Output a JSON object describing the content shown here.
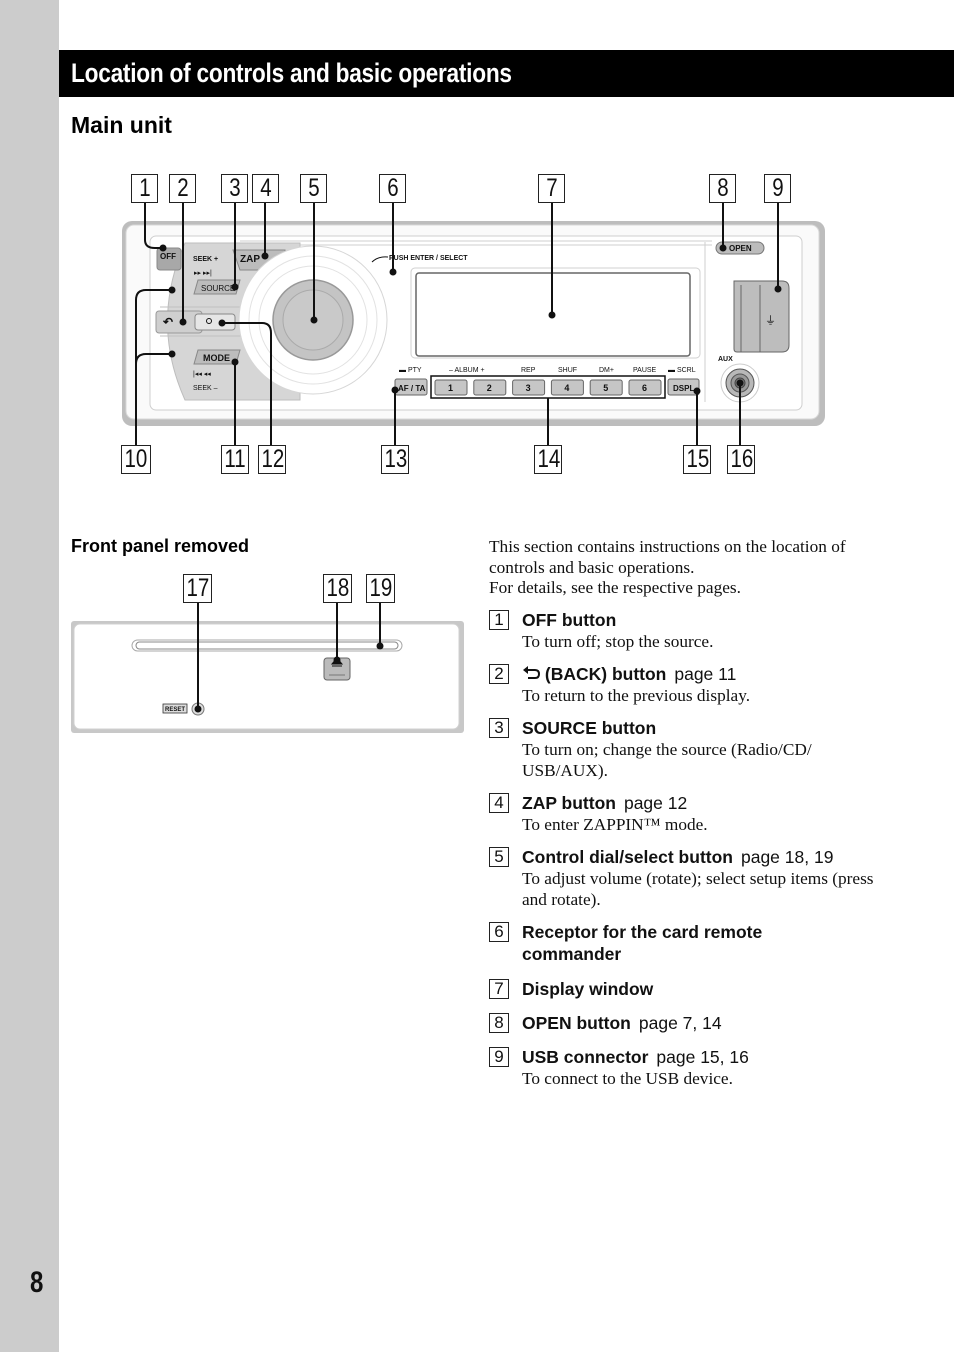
{
  "page": {
    "number": "8",
    "title": "Location of controls and basic operations"
  },
  "sections": {
    "main_unit": "Main unit",
    "front_panel_removed": "Front panel removed"
  },
  "main_unit_diagram": {
    "callouts_top": [
      "1",
      "2",
      "3",
      "4",
      "5",
      "6",
      "7",
      "8",
      "9"
    ],
    "callouts_bottom": [
      "10",
      "11",
      "12",
      "13",
      "14",
      "15",
      "16"
    ],
    "labels": {
      "off": "OFF",
      "seek_plus": "SEEK +",
      "seek_fwd_glyph": "▸▸ ▸▸|",
      "zap": "ZAP",
      "source": "SOURCE",
      "back_glyph": "↶",
      "search_glyph": "🔍",
      "mode": "MODE",
      "seek_back_glyph": "|◂◂ ◂◂",
      "seek_minus": "SEEK –",
      "push_enter_select": "PUSH ENTER / SELECT",
      "pty": "PTY",
      "af_ta": "AF / TA",
      "album": "–  ALBUM  +",
      "rep": "REP",
      "shuf": "SHUF",
      "dm_plus": "DM+",
      "pause": "PAUSE",
      "scrl": "SCRL",
      "dspl": "DSPL",
      "open": "OPEN",
      "aux": "AUX",
      "usb_glyph": "⭍"
    },
    "preset_buttons": [
      "1",
      "2",
      "3",
      "4",
      "5",
      "6"
    ]
  },
  "front_panel_diagram": {
    "callouts": [
      "17",
      "18",
      "19"
    ],
    "reset_label": "RESET",
    "eject_glyph": "≜"
  },
  "intro": [
    "This section contains instructions on the location of controls and basic operations.",
    "For details, see the respective pages."
  ],
  "items": [
    {
      "num": "1",
      "title": "OFF button",
      "page_ref": "",
      "desc": "To turn off; stop the source."
    },
    {
      "num": "2",
      "title": "(BACK) button",
      "page_ref": "page 11",
      "desc": "To return to the previous display.",
      "icon": "back-arrow"
    },
    {
      "num": "3",
      "title": "SOURCE button",
      "page_ref": "",
      "desc": "To turn on; change the source (Radio/CD/ USB/AUX)."
    },
    {
      "num": "4",
      "title": "ZAP button",
      "page_ref": "page 12",
      "desc": "To enter ZAPPIN™ mode."
    },
    {
      "num": "5",
      "title": "Control dial/select button",
      "page_ref": "page 18, 19",
      "desc": "To adjust volume (rotate); select setup items (press and rotate)."
    },
    {
      "num": "6",
      "title": "Receptor for the card remote commander",
      "page_ref": "",
      "desc": ""
    },
    {
      "num": "7",
      "title": "Display window",
      "page_ref": "",
      "desc": ""
    },
    {
      "num": "8",
      "title": "OPEN button",
      "page_ref": "page 7, 14",
      "desc": ""
    },
    {
      "num": "9",
      "title": "USB connector",
      "page_ref": "page 15, 16",
      "desc": "To connect to the USB device."
    }
  ]
}
